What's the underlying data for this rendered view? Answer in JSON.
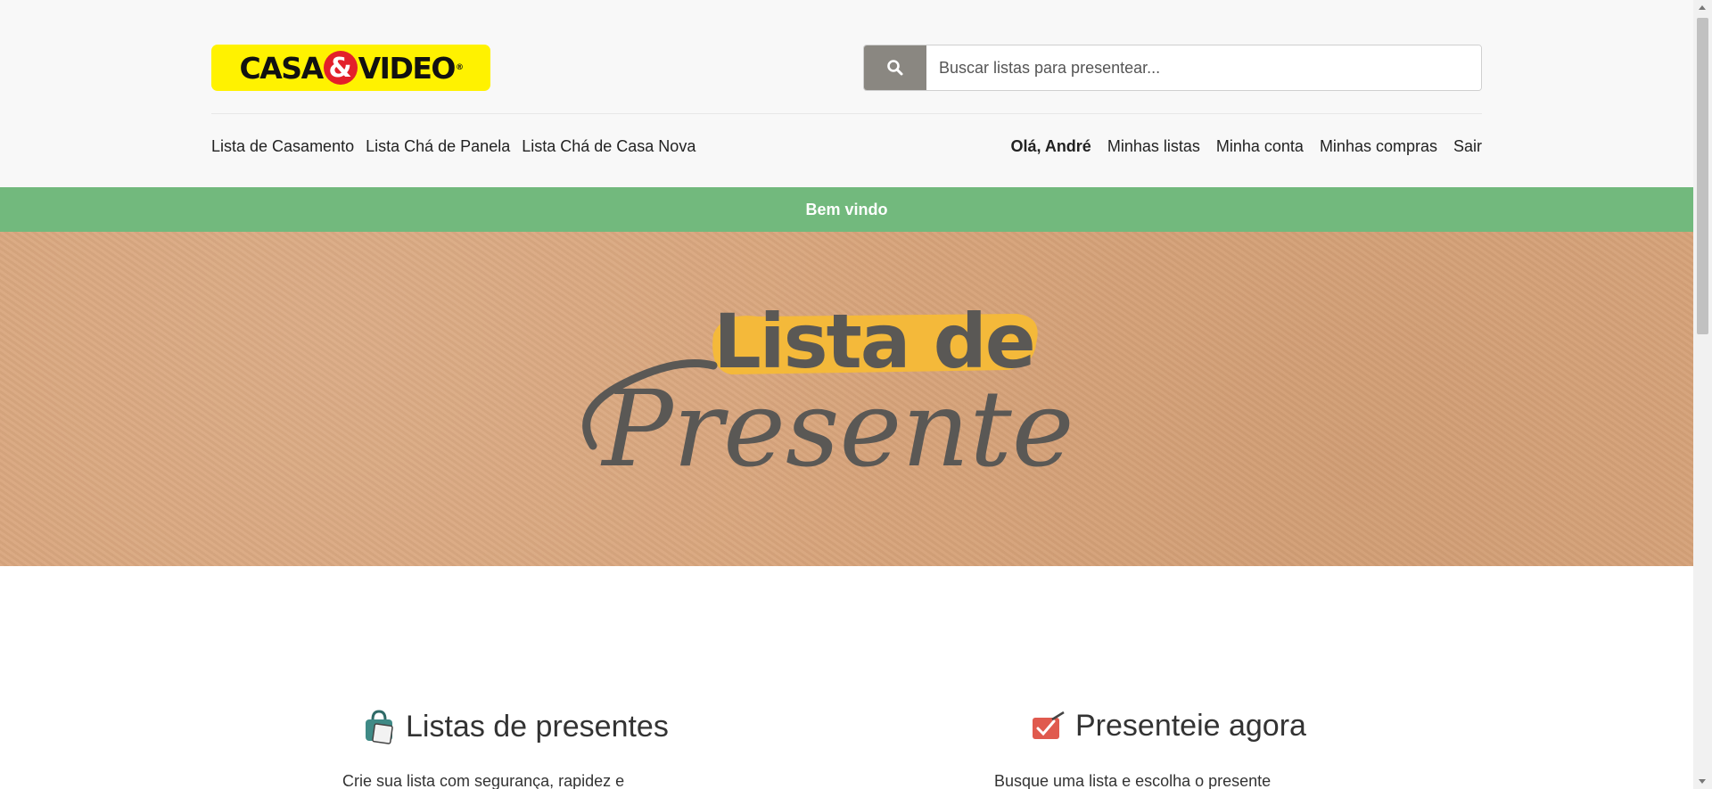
{
  "header": {
    "logo_text_left": "CASA",
    "logo_amp": "&",
    "logo_text_right": "VIDEO",
    "logo_reg": "®",
    "search_placeholder": "Buscar listas para presentear..."
  },
  "nav_left": [
    "Lista de Casamento",
    "Lista Chá de Panela",
    "Lista Chá de Casa Nova"
  ],
  "nav_right": {
    "greeting": "Olá, André",
    "items": [
      "Minhas listas",
      "Minha conta",
      "Minhas compras",
      "Sair"
    ]
  },
  "welcome_bar": "Bem vindo",
  "banner": {
    "line1": "Lista de",
    "line2": "Presente"
  },
  "features": [
    {
      "title": "Listas de presentes",
      "desc": "Crie sua lista com segurança, rapidez e",
      "icon": "gift-bag-icon"
    },
    {
      "title": "Presenteie agora",
      "desc": "Busque uma lista e escolha o presente",
      "icon": "checklist-icon"
    }
  ],
  "colors": {
    "logo_bg": "#fff200",
    "welcome_bar": "#72b97d",
    "banner_bg": "#d9a57c",
    "banner_highlight": "#f4b93a",
    "banner_text": "#5a5855"
  }
}
